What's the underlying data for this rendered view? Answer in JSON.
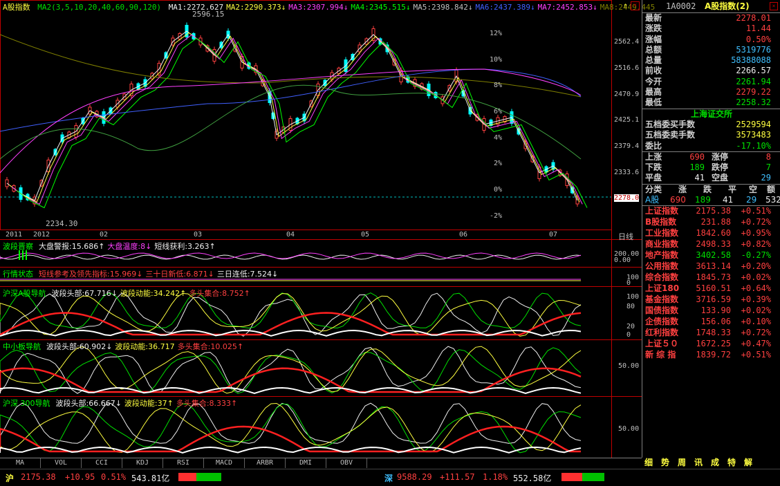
{
  "window": {
    "title": "A股指数",
    "code": "1A0002",
    "name": "A股指数(2)"
  },
  "ma_row": {
    "label": "A股指数",
    "params": "MA2(3,5,10,20,40,60,90,120)",
    "items": [
      {
        "text": "MA1:2272.627",
        "color": "#f0f0f0"
      },
      {
        "text": "MA2:2290.373↓",
        "color": "#ffff40"
      },
      {
        "text": "MA3:2307.994↓",
        "color": "#ff40ff"
      },
      {
        "text": "MA4:2345.515↓",
        "color": "#00ff00"
      },
      {
        "text": "MA5:2398.842↓",
        "color": "#c0c0c0"
      },
      {
        "text": "MA6:2437.389↓",
        "color": "#4060ff"
      },
      {
        "text": "MA7:2452.853↓",
        "color": "#ff40ff"
      },
      {
        "text": "MA8:2449.445",
        "color": "#808000"
      }
    ]
  },
  "main_axis": {
    "prices": [
      "2562.4",
      "2516.6",
      "2470.9",
      "2425.1",
      "2379.4",
      "2333.6",
      "2278.0"
    ],
    "pcts": [
      "12%",
      "10%",
      "8%",
      "6%",
      "4%",
      "2%",
      "0%",
      "-2%"
    ],
    "high_label": "2596.15",
    "low_label": "2234.30"
  },
  "x_axis": {
    "labels": [
      "2011",
      "2012",
      "02",
      "03",
      "04",
      "05",
      "06",
      "07"
    ],
    "period": "日线"
  },
  "sub1": {
    "title": "波段晋察",
    "items": [
      {
        "text": "大盘警报:15.686↑",
        "color": "#f0f0f0"
      },
      {
        "text": "大盘温度:8↓",
        "color": "#ff40ff"
      },
      {
        "text": "短线获利:3.263↑",
        "color": "#f0f0f0"
      }
    ],
    "ticks": [
      "200.00",
      "0.00"
    ]
  },
  "sub2": {
    "title": "行情状态",
    "items": [
      {
        "text": "短线参考及领先指标:15.969↓",
        "color": "#ff4040"
      },
      {
        "text": "三十日新低:6.871↓",
        "color": "#ff4040"
      },
      {
        "text": "三日连低:7.524↓",
        "color": "#f0f0f0"
      }
    ],
    "ticks": [
      "100",
      "0"
    ]
  },
  "sub3": {
    "title": "沪深A股导航",
    "items": [
      {
        "text": "波段头部:67.716↓",
        "color": "#f0f0f0"
      },
      {
        "text": "波段动能:34.242↑",
        "color": "#ffff40"
      },
      {
        "text": "多头集合:8.752↑",
        "color": "#ff4040"
      }
    ],
    "ticks": [
      "100",
      "80",
      "20",
      "0"
    ]
  },
  "sub4": {
    "title": "中小板导航",
    "items": [
      {
        "text": "波段头部:60.902↓",
        "color": "#f0f0f0"
      },
      {
        "text": "波段动能:36.717",
        "color": "#ffff40"
      },
      {
        "text": "多头集合:10.025↑",
        "color": "#ff4040"
      }
    ],
    "ticks": [
      "50.00"
    ]
  },
  "sub5": {
    "title": "沪深 300导航",
    "items": [
      {
        "text": "波段头部:66.667↓",
        "color": "#f0f0f0"
      },
      {
        "text": "波段动能:37↑",
        "color": "#ffff40"
      },
      {
        "text": "多头集合:8.333↑",
        "color": "#ff4040"
      }
    ],
    "ticks": [
      "50.00"
    ]
  },
  "tabs": [
    "MA",
    "VOL",
    "CCI",
    "KDJ",
    "RSI",
    "MACD",
    "ARBR",
    "DMI",
    "OBV"
  ],
  "quote": [
    {
      "label": "最新",
      "value": "2278.01",
      "cls": "r"
    },
    {
      "label": "涨跌",
      "value": "11.44",
      "cls": "r"
    },
    {
      "label": "涨幅",
      "value": "0.50%",
      "cls": "r"
    },
    {
      "label": "总额",
      "value": "5319776",
      "cls": "c"
    },
    {
      "label": "总量",
      "value": "58388088",
      "cls": "c"
    },
    {
      "label": "前收",
      "value": "2266.57",
      "cls": "w"
    },
    {
      "label": "今开",
      "value": "2261.94",
      "cls": "g"
    },
    {
      "label": "最高",
      "value": "2279.22",
      "cls": "r"
    },
    {
      "label": "最低",
      "value": "2258.32",
      "cls": "g"
    }
  ],
  "exchange": "上海证交所",
  "orders": [
    {
      "label": "五档委买手数",
      "value": "2529594",
      "cls": "y"
    },
    {
      "label": "五档委卖手数",
      "value": "3573483",
      "cls": "y"
    },
    {
      "label": "委比",
      "value": "-17.10%",
      "cls": "g"
    }
  ],
  "breadth": [
    {
      "l1": "上涨",
      "v1": "690",
      "c1": "r",
      "l2": "涨停",
      "v2": "8",
      "c2": "r"
    },
    {
      "l1": "下跌",
      "v1": "189",
      "c1": "g",
      "l2": "跌停",
      "v2": "7",
      "c2": "g"
    },
    {
      "l1": "平盘",
      "v1": "41",
      "c1": "w",
      "l2": "空盘",
      "v2": "29",
      "c2": "c"
    }
  ],
  "class_header": {
    "cols": [
      "分类",
      "涨",
      "跌",
      "平",
      "空",
      "额"
    ]
  },
  "class_row": {
    "name": "A股",
    "up": "690",
    "down": "189",
    "flat": "41",
    "empty": "29",
    "amt": "532"
  },
  "indices": [
    {
      "name": "上证指数",
      "value": "2175.38",
      "chg": "+0.51%",
      "cls": "r"
    },
    {
      "name": "B股指数",
      "value": "231.88",
      "chg": "+0.72%",
      "cls": "r"
    },
    {
      "name": "工业指数",
      "value": "1842.60",
      "chg": "+0.95%",
      "cls": "r"
    },
    {
      "name": "商业指数",
      "value": "2498.33",
      "chg": "+0.82%",
      "cls": "r"
    },
    {
      "name": "地产指数",
      "value": "3402.58",
      "chg": "-0.27%",
      "cls": "g"
    },
    {
      "name": "公用指数",
      "value": "3613.14",
      "chg": "+0.20%",
      "cls": "r"
    },
    {
      "name": "综合指数",
      "value": "1845.73",
      "chg": "+0.02%",
      "cls": "r"
    },
    {
      "name": "上证180",
      "value": "5160.51",
      "chg": "+0.64%",
      "cls": "r"
    },
    {
      "name": "基金指数",
      "value": "3716.59",
      "chg": "+0.39%",
      "cls": "r"
    },
    {
      "name": "国债指数",
      "value": "133.90",
      "chg": "+0.02%",
      "cls": "r"
    },
    {
      "name": "企债指数",
      "value": "156.06",
      "chg": "+0.10%",
      "cls": "r"
    },
    {
      "name": "红利指数",
      "value": "1748.33",
      "chg": "+0.72%",
      "cls": "r"
    },
    {
      "name": "上证５０",
      "value": "1672.25",
      "chg": "+0.47%",
      "cls": "r"
    },
    {
      "name": "新 综 指",
      "value": "1839.72",
      "chg": "+0.51%",
      "cls": "r"
    }
  ],
  "right_tabs": [
    "细",
    "势",
    "周",
    "讯",
    "成",
    "特",
    "解"
  ],
  "status": {
    "sh_label": "沪",
    "sh_value": "2175.38",
    "sh_chg": "+10.95",
    "sh_pct": "0.51%",
    "sh_amt": "543.81亿",
    "sz_label": "深",
    "sz_value": "9588.29",
    "sz_chg": "+111.57",
    "sz_pct": "1.18%",
    "sz_amt": "552.58亿"
  },
  "colors": {
    "up": "#ff4040",
    "down": "#00e000",
    "grid": "#800000",
    "axis": "#c00000"
  }
}
